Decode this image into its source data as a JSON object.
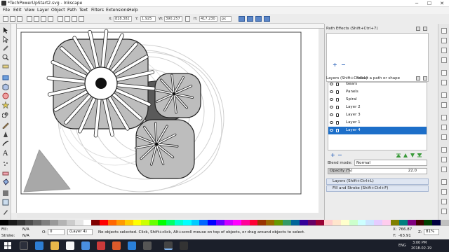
{
  "window": {
    "title": "*TechPowerUpStart2.svg - Inkscape",
    "minimize": "─",
    "maximize": "☐",
    "close": "✕"
  },
  "menu": [
    "File",
    "Edit",
    "View",
    "Layer",
    "Object",
    "Path",
    "Text",
    "Filters",
    "Extensions",
    "Help"
  ],
  "toolbar": {
    "x_label": "X:",
    "x_value": "818.382",
    "y_label": "Y:",
    "y_value": "1.925",
    "w_label": "W:",
    "w_value": "390.257",
    "h_label": "H:",
    "h_value": "417.230",
    "unit": "px"
  },
  "path_effects": {
    "title": "Path Effects (Shift+Ctrl+7)",
    "message": "Select a path or shape",
    "add": "+",
    "remove": "−"
  },
  "layers": {
    "title": "Layers (Shift+Ctrl+L)",
    "items": [
      {
        "name": "Gears"
      },
      {
        "name": "Panels"
      },
      {
        "name": "Spiral"
      },
      {
        "name": "Layer 2"
      },
      {
        "name": "Layer 3"
      },
      {
        "name": "Layer 1"
      },
      {
        "name": "Layer 4",
        "selected": true
      }
    ],
    "add": "+",
    "remove": "−",
    "blend_label": "Blend mode:",
    "blend_value": "Normal",
    "opacity_label": "Opacity (%)",
    "opacity_value": "22.0",
    "opacity_fraction": 0.22
  },
  "dock_tabs": {
    "layers_tab": "Layers (Shift+Ctrl+L)",
    "fill_tab": "Fill and Stroke (Shift+Ctrl+F)"
  },
  "status": {
    "fill_label": "Fill:",
    "fill_value": "N/A",
    "stroke_label": "Stroke:",
    "stroke_value": "N/A",
    "opacity_label": "O:",
    "opacity_value": "0",
    "layer_select": "(Layer 4)",
    "message": "No objects selected. Click, Shift+click, Alt+scroll mouse on top of objects, or drag around objects to select.",
    "x_label": "X:",
    "x_value": "766.87",
    "y_label": "Y:",
    "y_value": "-63.91",
    "z_label": "Z:",
    "zoom": "81%"
  },
  "taskbar": {
    "lang": "ENG",
    "time": "3:00 PM",
    "date": "2018-02-19"
  },
  "colors": {
    "selection": "#1d6fc9",
    "gear_fill": "#bdbdbd",
    "gear_dark": "#5a5a5a"
  }
}
